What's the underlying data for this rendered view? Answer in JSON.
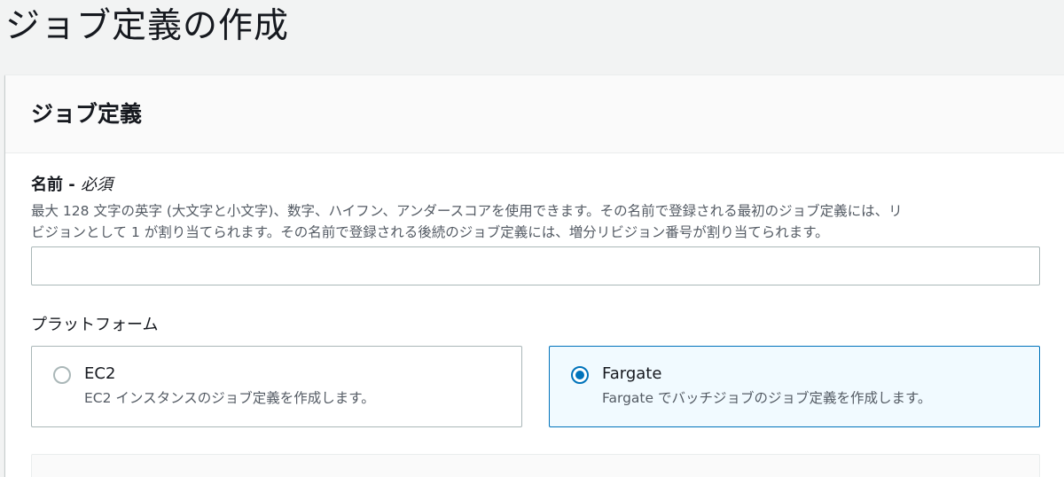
{
  "page": {
    "title": "ジョブ定義の作成"
  },
  "panel": {
    "title": "ジョブ定義"
  },
  "name_field": {
    "label": "名前 - ",
    "required": "必須",
    "description_line1": "最大 128 文字の英字 (大文字と小文字)、数字、ハイフン、アンダースコアを使用できます。その名前で登録される最初のジョブ定義には、リ",
    "description_line2": "ビジョンとして 1 が割り当てられます。その名前で登録される後続のジョブ定義には、増分リビジョン番号が割り当てられます。",
    "value": "",
    "placeholder": ""
  },
  "platform": {
    "label": "プラットフォーム",
    "selected": "Fargate",
    "options": [
      {
        "title": "EC2",
        "description": "EC2 インスタンスのジョブ定義を作成します。"
      },
      {
        "title": "Fargate",
        "description": "Fargate でバッチジョブのジョブ定義を作成します。"
      }
    ]
  },
  "colors": {
    "accent": "#0073bb",
    "selected_tile_bg": "#f1faff",
    "border": "#aab7b8",
    "text": "#16191f",
    "muted_text": "#545b64"
  }
}
